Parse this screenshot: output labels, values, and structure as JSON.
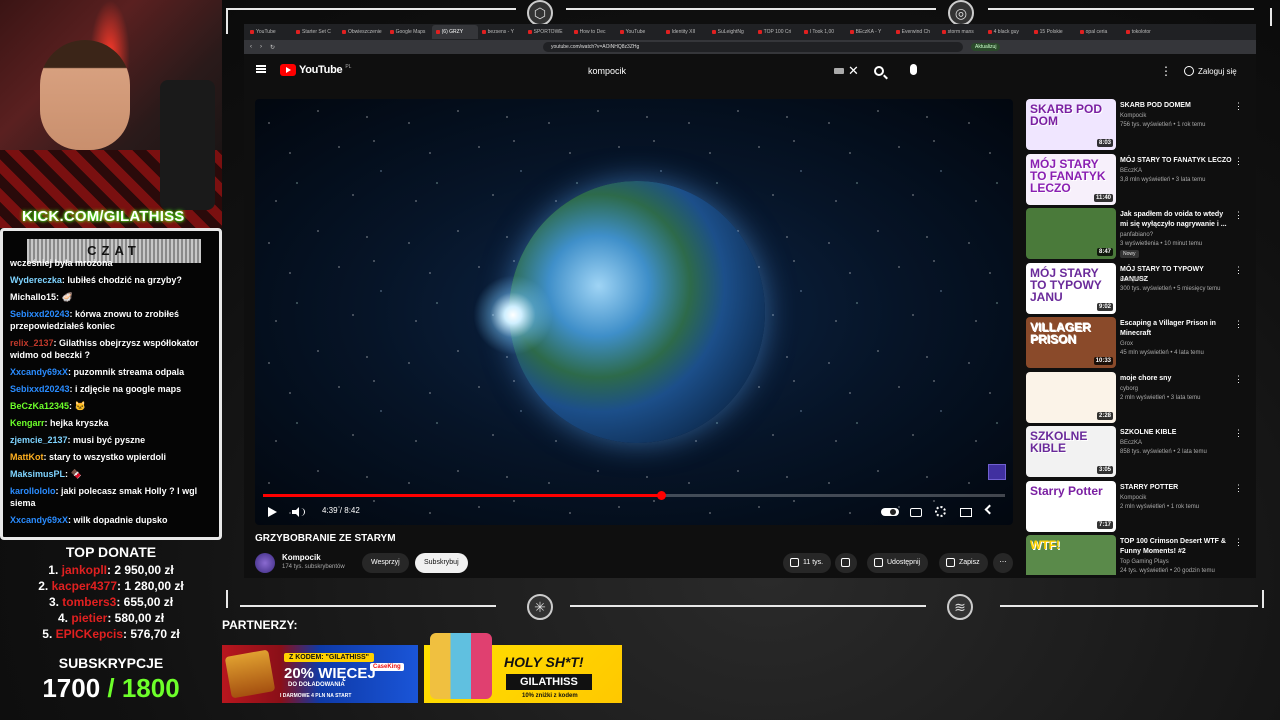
{
  "overlay": {
    "kick_url": "KICK.COM/GILATHISS",
    "chat_title": "CZAT",
    "chat": [
      {
        "user": "",
        "user_color": "#ffffff",
        "text": "wcześniej była mrożona"
      },
      {
        "user": "Wydereczka",
        "user_color": "#7fd4ff",
        "text": "lubiłeś chodzić na grzyby?"
      },
      {
        "user": "Michallo15",
        "user_color": "#ffffff",
        "text": "🦪"
      },
      {
        "user": "Sebixxd20243",
        "user_color": "#2a8cff",
        "text": "kórwa znowu to zrobiłeś przepowiedziałeś koniec"
      },
      {
        "user": "relix_2137",
        "user_color": "#c0392b",
        "text": "Gilathiss obejrzysz współlokator widmo od beczki ?"
      },
      {
        "user": "Xxcandy69xX",
        "user_color": "#2a8cff",
        "text": "puzomnik streama odpala"
      },
      {
        "user": "Sebixxd20243",
        "user_color": "#2a8cff",
        "text": "i zdjęcie na google maps"
      },
      {
        "user": "BeCzKa12345",
        "user_color": "#6dff2a",
        "text": "🐱"
      },
      {
        "user": "Kengarr",
        "user_color": "#6dff2a",
        "text": "hejka kryszka"
      },
      {
        "user": "zjemcie_2137",
        "user_color": "#7fd4ff",
        "text": "musi być pyszne"
      },
      {
        "user": "MattKot",
        "user_color": "#ffb020",
        "text": "stary to wszystko wpierdoli"
      },
      {
        "user": "MaksimusPL",
        "user_color": "#7fd4ff",
        "text": "🍫"
      },
      {
        "user": "karollololo",
        "user_color": "#2a8cff",
        "text": "jaki polecasz smak Holly ? I wgl siema"
      },
      {
        "user": "Xxcandy69xX",
        "user_color": "#2a8cff",
        "text": "wilk dopadnie dupsko"
      }
    ],
    "donate_title": "TOP DONATE",
    "donors": [
      {
        "rank": "1.",
        "name": "jankoplI",
        "amount": "2 950,00 zł"
      },
      {
        "rank": "2.",
        "name": "kacper4377",
        "amount": "1 280,00 zł"
      },
      {
        "rank": "3.",
        "name": "tombers3",
        "amount": "655,00 zł"
      },
      {
        "rank": "4.",
        "name": "pietier",
        "amount": "580,00 zł"
      },
      {
        "rank": "5.",
        "name": "EPICKepcis",
        "amount": "576,70 zł"
      }
    ],
    "subs_title": "SUBSKRYPCJE",
    "subs_current": "1700",
    "subs_goal": "/ 1800",
    "partners_label": "PARTNERZY:",
    "banner1": {
      "code": "Z KODEM: \"GILATHISS\"",
      "headline": "20% WIĘCEJ",
      "line2": "DO DOŁADOWANIA",
      "line3": "I DARMOWE 4 PLN NA START",
      "brand": "CaseKing"
    },
    "banner2": {
      "headline": "HOLY SH*T!",
      "code": "GILATHISS",
      "line3": "10% zniżki z kodem"
    }
  },
  "browser": {
    "tabs": [
      {
        "label": "YouTube",
        "active": false
      },
      {
        "label": "Starter Set C",
        "active": false
      },
      {
        "label": "Obwieszczenie",
        "active": false
      },
      {
        "label": "Google Maps",
        "active": false
      },
      {
        "label": "(6) GRZY",
        "active": true
      },
      {
        "label": "bezsens - Y",
        "active": false
      },
      {
        "label": "SPORTOWE",
        "active": false
      },
      {
        "label": "How to Dec",
        "active": false
      },
      {
        "label": "YouTube",
        "active": false
      },
      {
        "label": "Identity XII",
        "active": false
      },
      {
        "label": "SuLeightNg",
        "active": false
      },
      {
        "label": "TOP 100 Cri",
        "active": false
      },
      {
        "label": "I Took 1,00",
        "active": false
      },
      {
        "label": "BEczKA - Y",
        "active": false
      },
      {
        "label": "Everwind Ch",
        "active": false
      },
      {
        "label": "storm mans",
        "active": false
      },
      {
        "label": "4 black guy",
        "active": false
      },
      {
        "label": "15 Polskie",
        "active": false
      },
      {
        "label": "opal ceria",
        "active": false
      },
      {
        "label": "tokolotor",
        "active": false
      }
    ],
    "url": "youtube.com/watch?v=AOiNHQ8z3ZHg",
    "update_label": "Aktualizuj"
  },
  "youtube": {
    "logo_text": "YouTube",
    "logo_country": "PL",
    "search_value": "kompocik",
    "signin_label": "Zaloguj się",
    "player": {
      "time_current": "4:39",
      "time_total": "8:42",
      "progress_fraction": 0.5359
    },
    "video_title": "GRZYBOBRANIE ZE STARYM",
    "channel_name": "Kompocik",
    "channel_subs": "174 tys. subskrybentów",
    "support_label": "Wesprzyj",
    "subscribe_label": "Subskrybuj",
    "like_count": "11 tys.",
    "share_label": "Udostępnij",
    "save_label": "Zapisz",
    "recommendations": [
      {
        "title": "SKARB POD DOMEM",
        "channel": "Kompocik",
        "meta": "756 tys. wyświetleń • 1 rok temu",
        "duration": "8:03",
        "thumb_text": "SKARB POD DOM",
        "thumb_bg": "#f0e6ff",
        "thumb_color": "#7a1fa2",
        "badge": ""
      },
      {
        "title": "MÓJ STARY TO FANATYK LECZO",
        "channel": "BEczKA",
        "meta": "3,8 mln wyświetleń • 3 lata temu",
        "duration": "11:40",
        "thumb_text": "MÓJ STARY TO FANATYK LECZO",
        "thumb_bg": "#f7f0fb",
        "thumb_color": "#8a1fb2",
        "badge": ""
      },
      {
        "title": "Jak spadłem do voida to wtedy mi się wyłączyło nagrywanie i ...",
        "channel": "panfabiano?",
        "meta": "3 wyświetlenia • 10 minut temu",
        "duration": "8:47",
        "thumb_text": "",
        "thumb_bg": "#4a7a3a",
        "thumb_color": "#ffffff",
        "badge": "Nowy"
      },
      {
        "title": "MÓJ STARY TO TYPOWY JANUSZ",
        "channel": "Kompocik",
        "meta": "300 tys. wyświetleń • 5 miesięcy temu",
        "duration": "9:02",
        "thumb_text": "MÓJ STARY TO TYPOWY JANU",
        "thumb_bg": "#ffffff",
        "thumb_color": "#6a2a9a",
        "badge": ""
      },
      {
        "title": "Escaping a Villager Prison in Minecraft",
        "channel": "Grox",
        "meta": "45 mln wyświetleń • 4 lata temu",
        "duration": "10:33",
        "thumb_text": "VILLAGER PRISON",
        "thumb_bg": "#8a4a2a",
        "thumb_color": "#ffffff",
        "badge": ""
      },
      {
        "title": "moje chore sny",
        "channel": "cyborg",
        "meta": "2 mln wyświetleń • 3 lata temu",
        "duration": "2:28",
        "thumb_text": "",
        "thumb_bg": "#fbf3e8",
        "thumb_color": "#b060c0",
        "badge": ""
      },
      {
        "title": "SZKOLNE KIBLE",
        "channel": "BEczKA",
        "meta": "858 tys. wyświetleń • 2 lata temu",
        "duration": "3:05",
        "thumb_text": "SZKOLNE KIBLE",
        "thumb_bg": "#f2f2f2",
        "thumb_color": "#6a2a9a",
        "badge": ""
      },
      {
        "title": "STARRY POTTER",
        "channel": "Kompocik",
        "meta": "2 mln wyświetleń • 1 rok temu",
        "duration": "7:17",
        "thumb_text": "Starry Potter",
        "thumb_bg": "#ffffff",
        "thumb_color": "#7a1fa2",
        "badge": ""
      },
      {
        "title": "TOP 100 Crimson Desert WTF & Funny Moments! #2",
        "channel": "Top Gaming Plays",
        "meta": "24 tys. wyświetleń • 20 godzin temu",
        "duration": "",
        "thumb_text": "WTF!",
        "thumb_bg": "#5a8a4a",
        "thumb_color": "#ffd200",
        "badge": ""
      }
    ]
  }
}
